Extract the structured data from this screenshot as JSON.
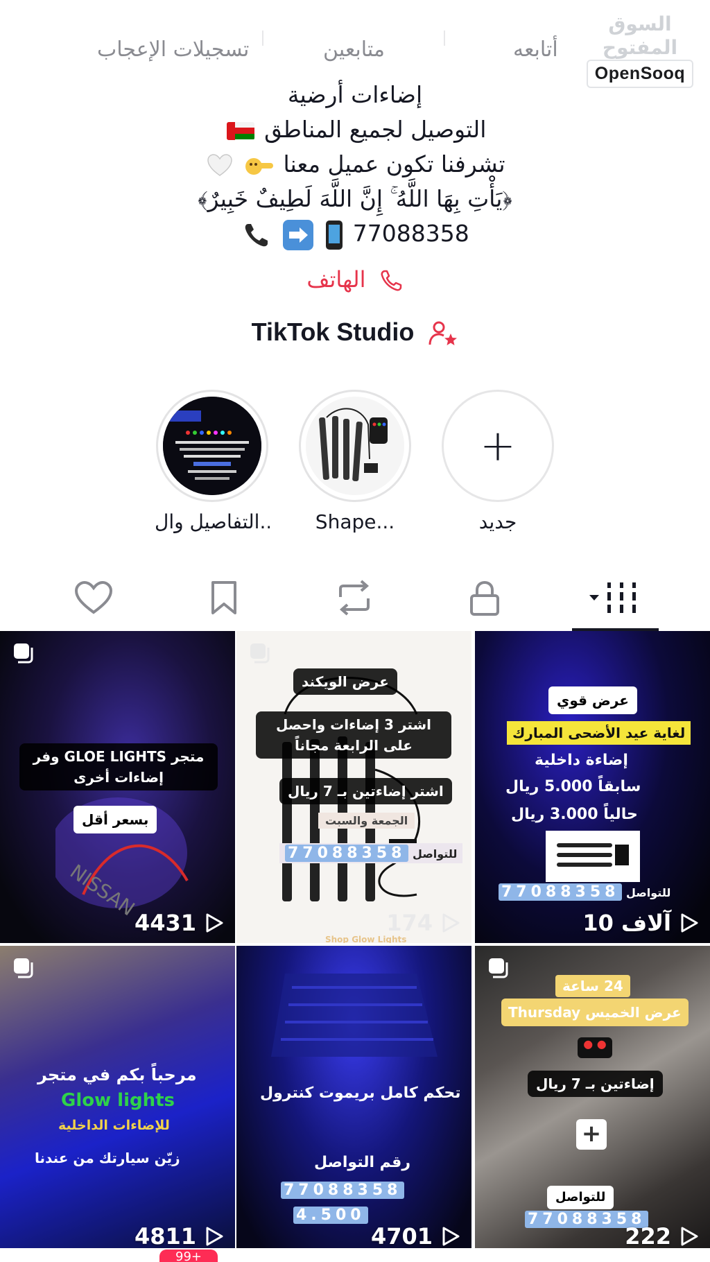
{
  "watermark": {
    "arabic": "السوق المفتوح",
    "brand": "OpenSooq"
  },
  "stats": {
    "likes_label": "تسجيلات الإعجاب",
    "followers_label": "متابعين",
    "following_label": "أتابعه"
  },
  "bio": {
    "line1": "إضاءات أرضية",
    "line2": "التوصيل لجميع المناطق",
    "line3": "تشرفنا تكون عميل معنا",
    "line4": "﴿يَأْتِ بِهَا اللَّهُ ۚ إِنَّ اللَّهَ لَطِيفٌ خَبِيرٌ﴾",
    "phone": "77088358"
  },
  "phone_link": {
    "label": "الهاتف"
  },
  "studio": {
    "label": "TikTok Studio"
  },
  "highlights": [
    {
      "label": "التفاصيل وال..."
    },
    {
      "label": "Shape..."
    },
    {
      "label": "جديد"
    }
  ],
  "tabs": [
    "videos",
    "private",
    "reposts",
    "favorites",
    "liked"
  ],
  "videos": [
    {
      "views": "4431",
      "caption1": "متجر GLOE LIGHTS وفر إضاءات أخرى",
      "caption2": "بسعر أقل"
    },
    {
      "views": "174",
      "caption1": "عرض الويكند",
      "caption2": "اشتر 3 إضاءات واحصل على الرابعة مجاناً",
      "caption3": "اشتر إضاءتين بـ 7 ريال",
      "caption4": "الجمعة والسبت",
      "caption5": "للتواصل",
      "phone": "77088358",
      "footer": "Shop Glow Lights"
    },
    {
      "views": "10 آلاف",
      "caption1": "عرض قوي",
      "caption2": "لغاية عيد الأضحى المبارك",
      "caption3": "إضاءة داخلية",
      "caption4": "سابقاً 5.000 ريال",
      "caption5": "حالياً 3.000 ريال",
      "caption6": "للتواصل",
      "phone": "77088358"
    },
    {
      "views": "4811",
      "caption1": "مرحباً بكم في متجر",
      "caption2": "Glow lights",
      "caption3": "للإضاءات الداخلية",
      "caption4": "زيّن سيارتك من عندنا"
    },
    {
      "views": "4701",
      "caption1": "تحكم كامل بريموت كنترول",
      "caption2": "رقم التواصل",
      "phone": "77088358",
      "price": "4.500"
    },
    {
      "views": "222",
      "caption1": "24 ساعة",
      "caption2": "عرض الخميس Thursday",
      "caption3": "إضاءتين بـ 7 ريال",
      "caption4": "للتواصل",
      "phone": "77088358"
    }
  ],
  "inbox_badge": "99+"
}
